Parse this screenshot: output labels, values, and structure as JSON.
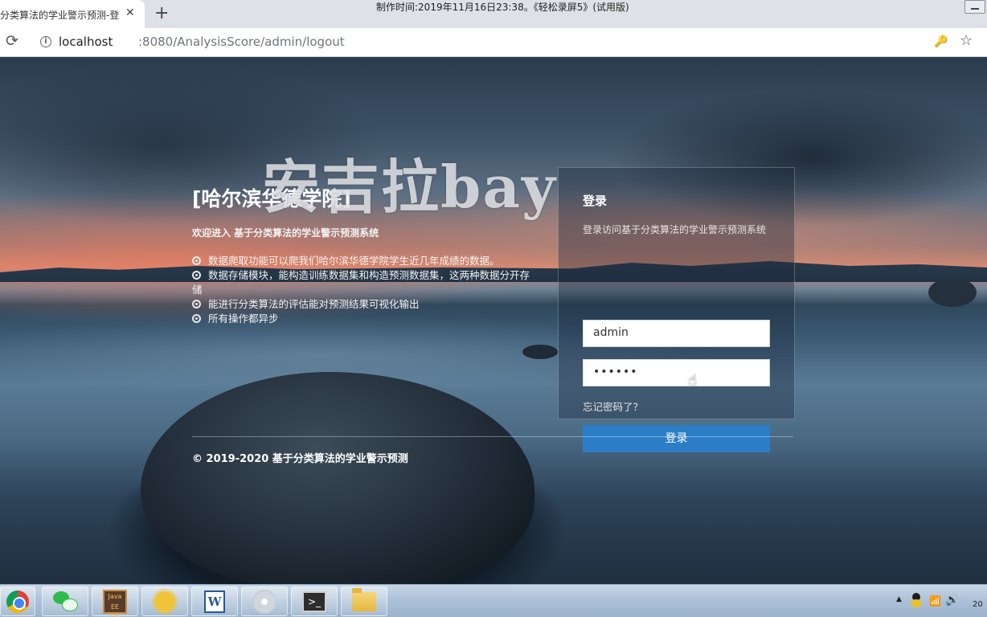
{
  "browser": {
    "tab_title": "分类算法的学业警示预测-登",
    "tab_close": "✕",
    "new_tab": "+",
    "address_host": "localhost",
    "address_path": ":8080/AnalysisScore/admin/logout",
    "recorder_note": "制作时间:2019年11月16日23:38。《轻松录屏5》(试用版)"
  },
  "page": {
    "watermark": "安吉拉bay",
    "school": "[哈尔滨华德学院]",
    "welcome": "欢迎进入 基于分类算法的学业警示预测系统",
    "features": [
      "数据爬取功能可以爬我们哈尔滨华德学院学生近几年成绩的数据。",
      "数据存储模块，能构造训练数据集和构造预测数据集，这两种数据分开存储",
      "能进行分类算法的评估能对预测结果可视化输出",
      "所有操作都异步"
    ],
    "copyright": "© 2019-2020 基于分类算法的学业警示预测"
  },
  "login": {
    "title": "登录",
    "subtitle": "登录访问基于分类算法的学业警示预测系统",
    "username": "admin",
    "password_mask": "••••••",
    "forgot": "忘记密码了？",
    "submit": "登录"
  },
  "taskbar": {
    "apps": [
      "chrome-icon",
      "wechat-icon",
      "java-ide-icon",
      "sun-app-icon",
      "word-icon",
      "disc-icon",
      "cmd-icon",
      "explorer-icon"
    ],
    "java_label": "Java EE IDE",
    "word_label": "W",
    "cmd_label": ">_",
    "tray_arrow": "▲",
    "tray_net": "📶",
    "tray_vol": "🔊",
    "clock": "20"
  }
}
